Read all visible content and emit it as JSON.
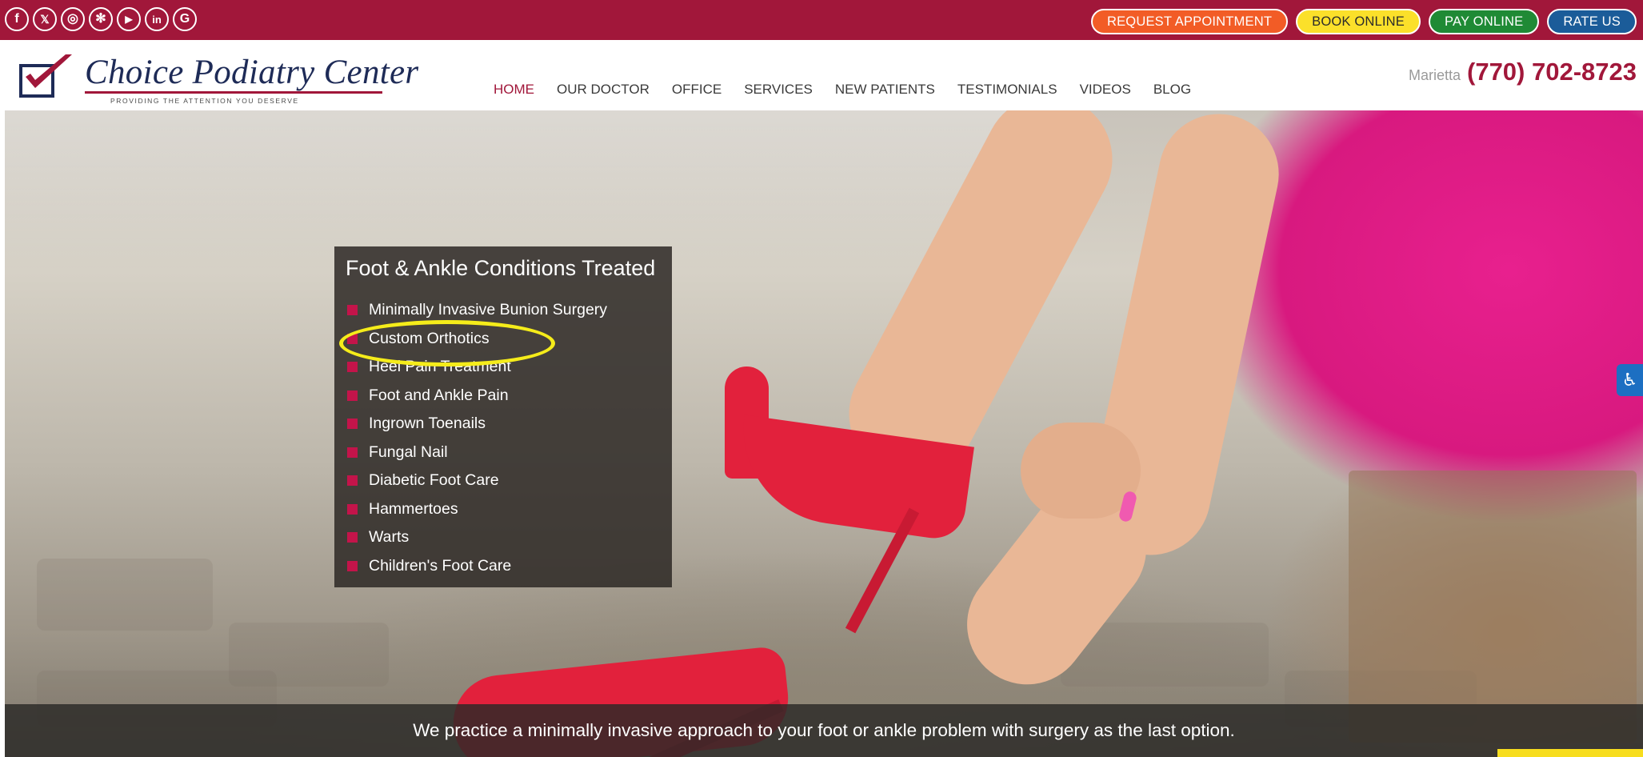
{
  "social": {
    "icons": [
      {
        "name": "facebook-icon",
        "glyph": "f"
      },
      {
        "name": "x-twitter-icon",
        "glyph": "𝕏"
      },
      {
        "name": "instagram-icon",
        "glyph": "◎"
      },
      {
        "name": "yelp-icon",
        "glyph": "✻"
      },
      {
        "name": "youtube-icon",
        "glyph": "▶"
      },
      {
        "name": "linkedin-icon",
        "glyph": "in"
      },
      {
        "name": "google-icon",
        "glyph": "G"
      }
    ]
  },
  "top_buttons": {
    "request": "REQUEST APPOINTMENT",
    "book": "BOOK ONLINE",
    "pay": "PAY ONLINE",
    "rate": "RATE US"
  },
  "logo": {
    "name": "Choice Podiatry Center",
    "tagline": "PROVIDING THE ATTENTION YOU DESERVE"
  },
  "contact": {
    "city": "Marietta",
    "phone": "(770) 702-8723"
  },
  "nav": {
    "items": [
      "HOME",
      "OUR DOCTOR",
      "OFFICE",
      "SERVICES",
      "NEW PATIENTS",
      "TESTIMONIALS",
      "VIDEOS",
      "BLOG"
    ],
    "active": "HOME"
  },
  "conditions": {
    "title": "Foot & Ankle Conditions Treated",
    "items": [
      "Minimally Invasive Bunion Surgery",
      "Custom Orthotics",
      "Heel Pain Treatment",
      "Foot and Ankle Pain",
      "Ingrown Toenails",
      "Fungal Nail",
      "Diabetic Foot Care",
      "Hammertoes",
      "Warts",
      "Children's Foot Care"
    ],
    "highlighted": "Custom Orthotics"
  },
  "banner": {
    "text": "We practice a minimally invasive approach to your foot or ankle problem with surgery as the last option."
  },
  "colors": {
    "brand": "#a1173a",
    "request": "#f25c26",
    "book": "#fbe02a",
    "pay": "#1f8a35",
    "rate": "#1b5c99",
    "highlight_circle": "#f5ec1a"
  }
}
